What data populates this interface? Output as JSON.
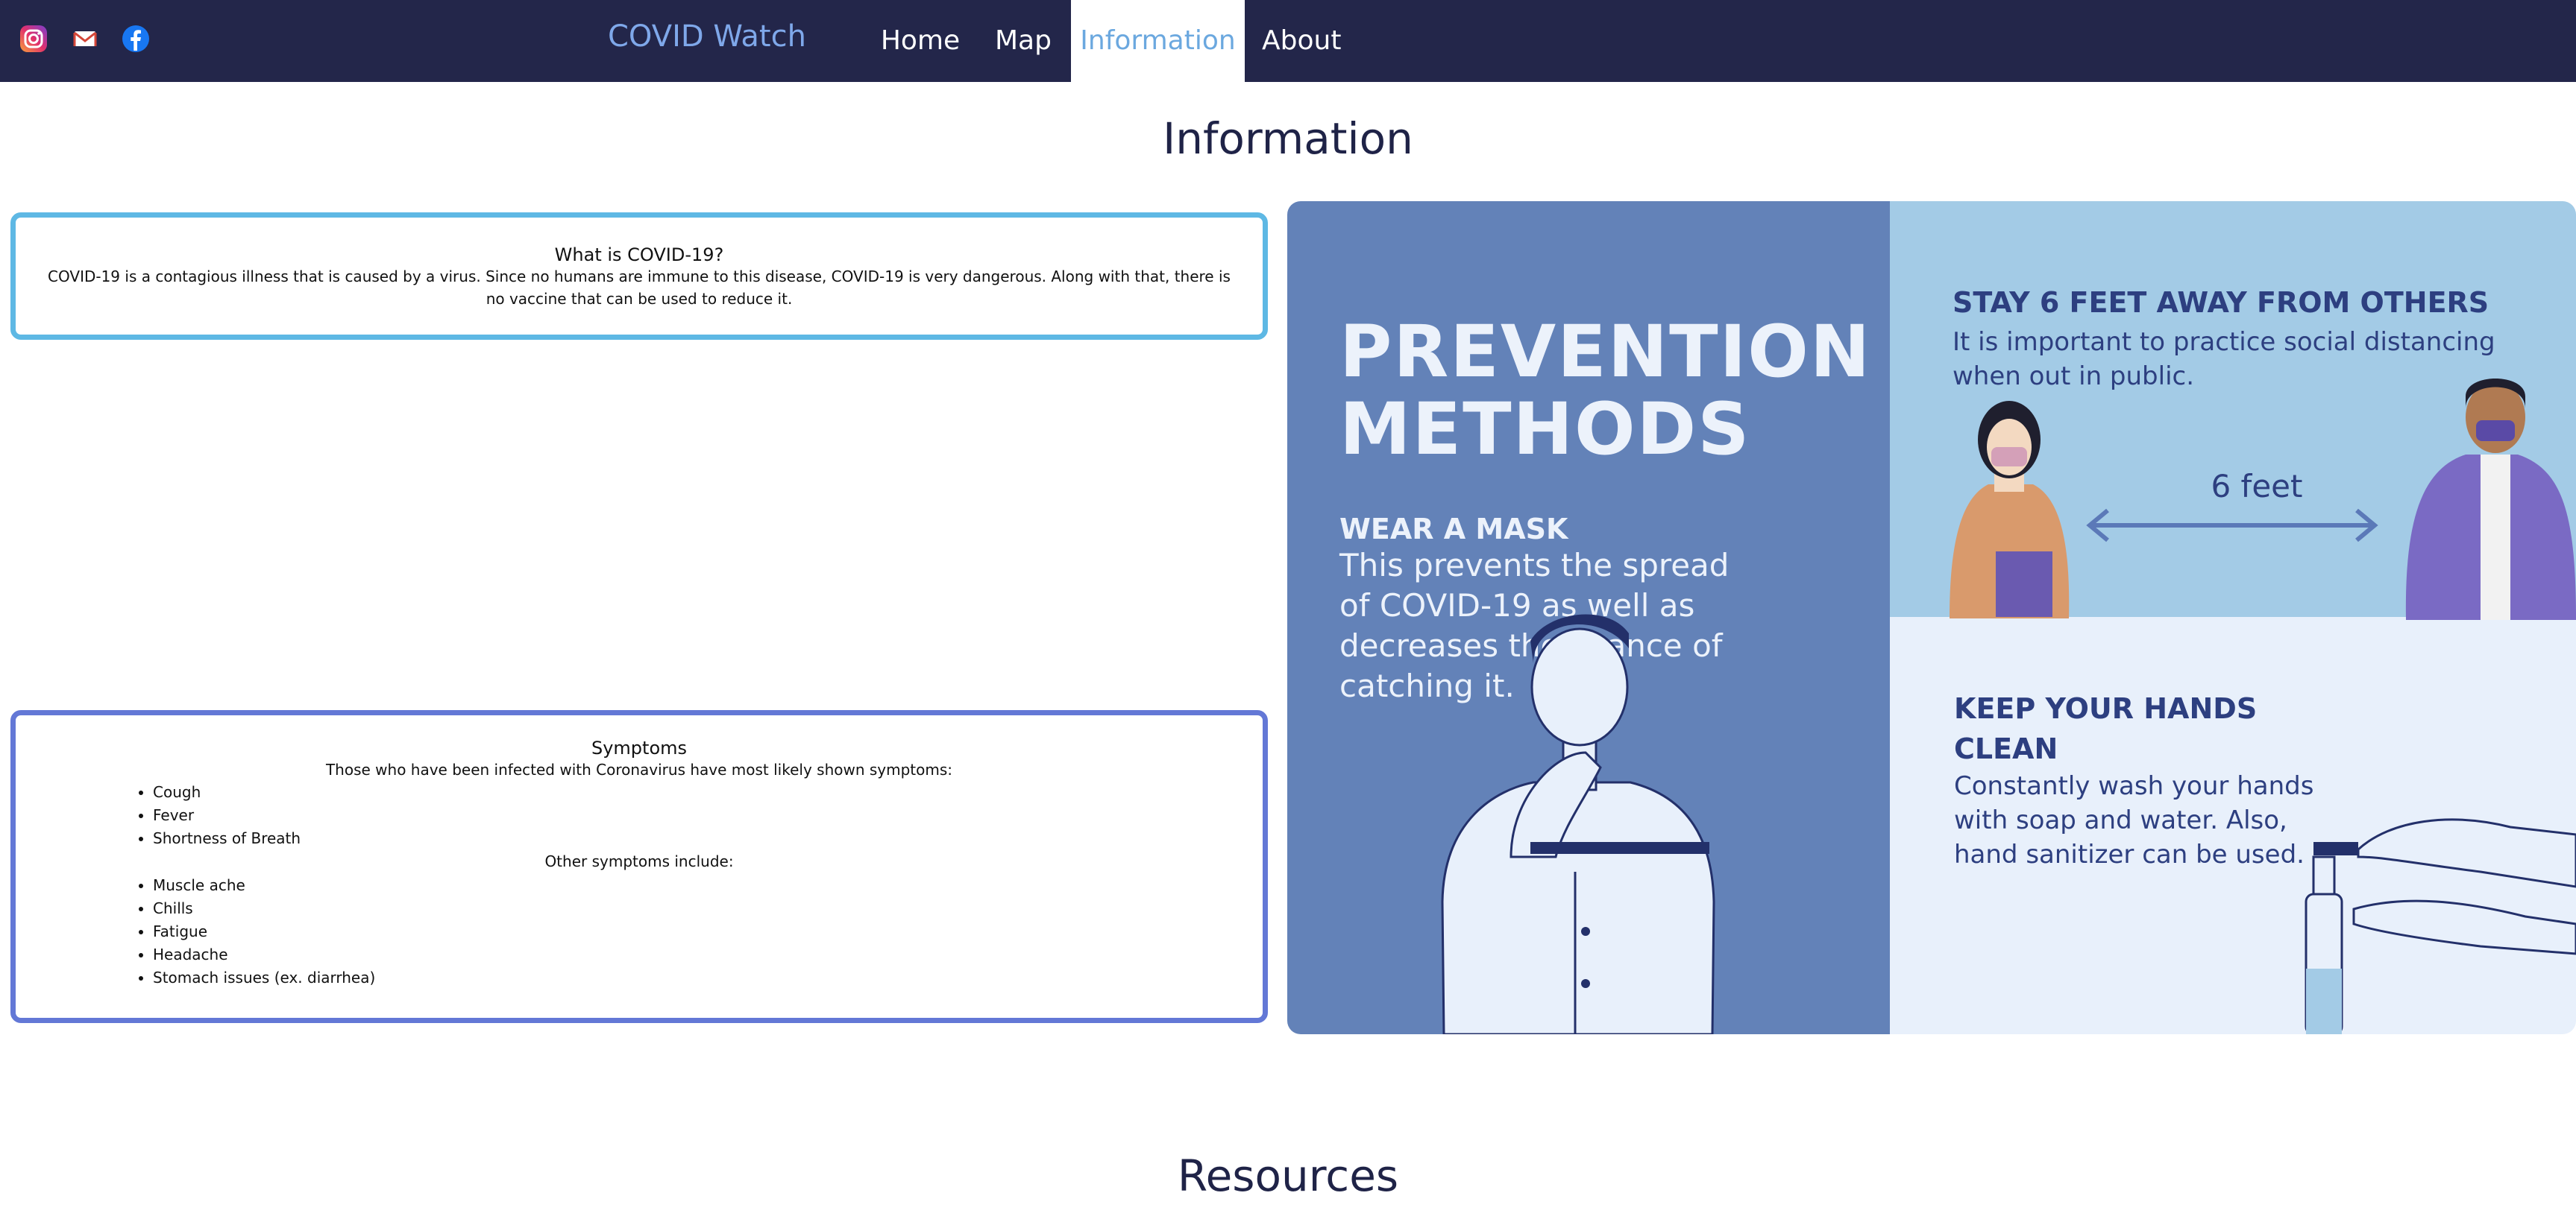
{
  "nav": {
    "brand": "COVID Watch",
    "social": [
      "instagram-icon",
      "mail-icon",
      "facebook-icon"
    ],
    "links": [
      {
        "label": "Home",
        "active": false
      },
      {
        "label": "Map",
        "active": false
      },
      {
        "label": "Information",
        "active": true
      },
      {
        "label": "About",
        "active": false
      }
    ]
  },
  "page": {
    "title": "Information",
    "resources_title": "Resources"
  },
  "what_is": {
    "heading": "What is COVID-19?",
    "text": "COVID-19 is a contagious illness that is caused by a virus. Since no humans are immune to this disease, COVID-19 is very dangerous. Along with that, there is no vaccine that can be used to reduce it."
  },
  "symptoms": {
    "heading": "Symptoms",
    "intro": "Those who have been infected with Coronavirus have most likely shown symptoms:",
    "main": [
      "Cough",
      "Fever",
      "Shortness of Breath"
    ],
    "other_label": "Other symptoms include:",
    "other": [
      "Muscle ache",
      "Chills",
      "Fatigue",
      "Headache",
      "Stomach issues (ex. diarrhea)"
    ]
  },
  "infographic": {
    "title_line1": "PREVENTION",
    "title_line2": "METHODS",
    "mask_heading": "WEAR A MASK",
    "mask_text": [
      "This prevents the spread",
      "of COVID-19 as well as",
      "decreases the chance of",
      "catching it."
    ],
    "distance_heading": "STAY 6 FEET AWAY FROM OTHERS",
    "distance_text": [
      "It is important to practice social distancing",
      "when out in public."
    ],
    "distance_label": "6 feet",
    "hands_heading": [
      "KEEP YOUR HANDS",
      "CLEAN"
    ],
    "hands_text": [
      "Constantly wash your hands",
      "with soap and water. Also,",
      "hand sanitizer can be used."
    ]
  },
  "colors": {
    "nav_bg": "#23264a",
    "brand": "#7fa8ea",
    "what_border": "#5eb8e4",
    "symptoms_border": "#6378d6"
  }
}
